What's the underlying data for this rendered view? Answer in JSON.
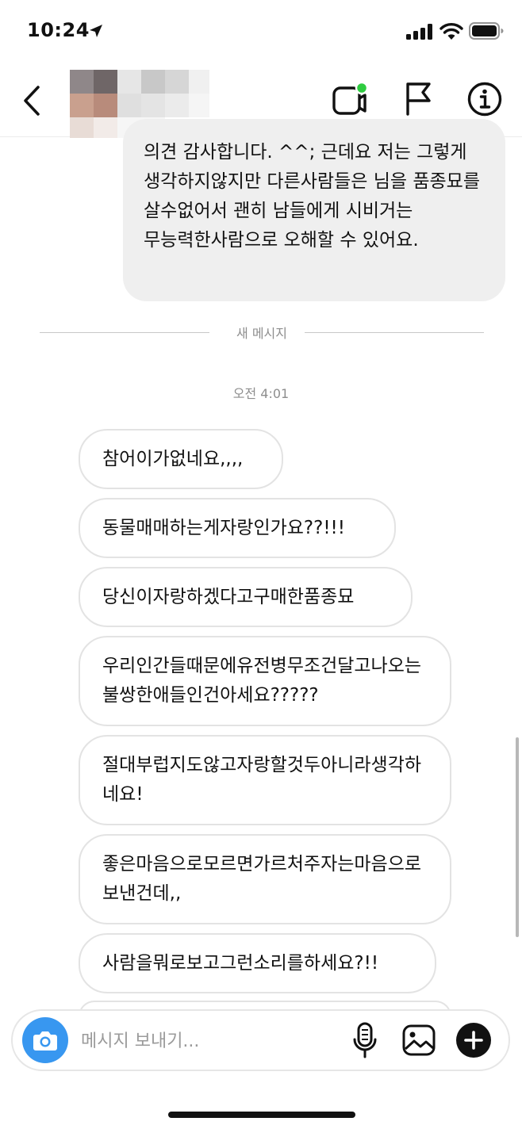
{
  "status_bar": {
    "time": "10:24",
    "icons": [
      "location-arrow-icon",
      "cellular-signal-icon",
      "wifi-icon",
      "battery-icon"
    ]
  },
  "header": {
    "back_icon": "chevron-left-icon",
    "contact_name": "",
    "actions": [
      "video-chat-icon",
      "flag-icon",
      "info-icon"
    ],
    "online_indicator_color": "#2ecc40"
  },
  "thread": {
    "sent_messages": [
      {
        "text": "의견 감사합니다. ^^; 근데요 저는 그렇게 생각하지않지만 다른사람들은 님을 품종묘를 살수없어서 괜히 남들에게 시비거는 무능력한사람으로 오해할 수 있어요."
      }
    ],
    "new_messages_divider": "새 메시지",
    "timestamp": "오전 4:01",
    "received_messages": [
      {
        "text": "참어이가없네요,,,,"
      },
      {
        "text": "동물매매하는게자랑인가요??!!!"
      },
      {
        "text": "당신이자랑하겠다고구매한품종묘"
      },
      {
        "text": "우리인간들때문에유전병무조건달고나오는불쌍한애들인건아세요?????"
      },
      {
        "text": "절대부럽지도않고자랑할것두아니라생각하네요!"
      },
      {
        "text": "좋은마음으로모르면가르처주자는마음으로보낸건데,,"
      },
      {
        "text": "사람을뭐로보고그런소리를하세요?!!"
      }
    ]
  },
  "composer": {
    "placeholder": "메시지 보내기...",
    "value": "",
    "icons": [
      "camera-icon",
      "microphone-icon",
      "gallery-icon",
      "plus-icon"
    ],
    "camera_color": "#3897f0"
  },
  "colors": {
    "sent_bubble": "#efefef",
    "received_border": "#e3e3e3",
    "muted_text": "#8e8e8e"
  }
}
